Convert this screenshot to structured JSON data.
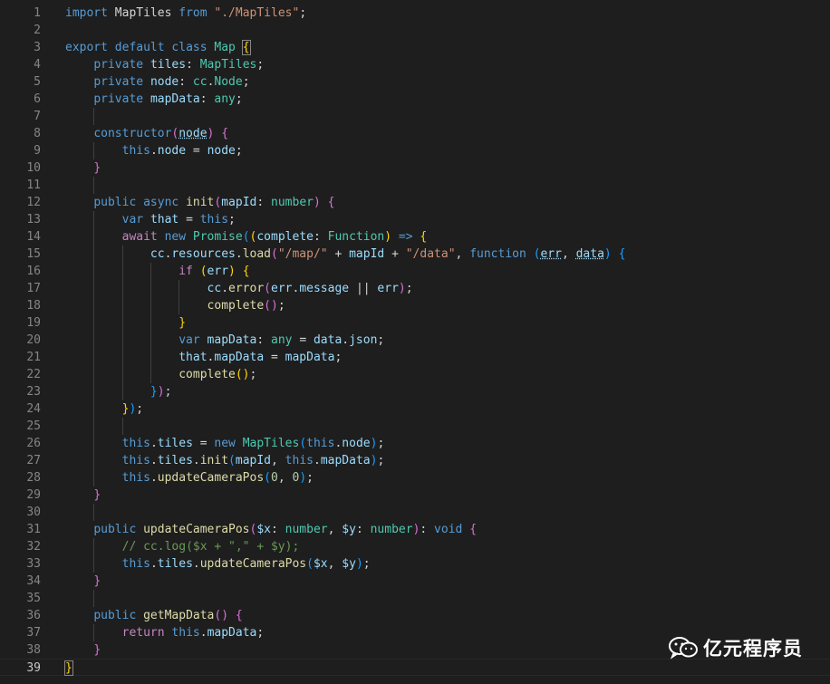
{
  "editor": {
    "current_line": 39,
    "lines": [
      {
        "n": "1",
        "t": [
          [
            "kw",
            "import "
          ],
          [
            "",
            "MapTiles "
          ],
          [
            "kw",
            "from "
          ],
          [
            "str",
            "\"./MapTiles\""
          ],
          [
            "",
            ";"
          ]
        ]
      },
      {
        "n": "2",
        "t": []
      },
      {
        "n": "3",
        "t": [
          [
            "kw",
            "export "
          ],
          [
            "kw",
            "default "
          ],
          [
            "kw",
            "class "
          ],
          [
            "typ",
            "Map "
          ],
          [
            "br1 brm",
            "{"
          ]
        ]
      },
      {
        "n": "4",
        "t": [
          [
            "",
            "    "
          ],
          [
            "kw",
            "private "
          ],
          [
            "var",
            "tiles"
          ],
          [
            "",
            ": "
          ],
          [
            "typ",
            "MapTiles"
          ],
          [
            "",
            ";"
          ]
        ]
      },
      {
        "n": "5",
        "t": [
          [
            "",
            "    "
          ],
          [
            "kw",
            "private "
          ],
          [
            "var",
            "node"
          ],
          [
            "",
            ": "
          ],
          [
            "typ",
            "cc"
          ],
          [
            "",
            "."
          ],
          [
            "typ",
            "Node"
          ],
          [
            "",
            ";"
          ]
        ]
      },
      {
        "n": "6",
        "t": [
          [
            "",
            "    "
          ],
          [
            "kw",
            "private "
          ],
          [
            "var",
            "mapData"
          ],
          [
            "",
            ": "
          ],
          [
            "typ",
            "any"
          ],
          [
            "",
            ";"
          ]
        ]
      },
      {
        "n": "7",
        "t": []
      },
      {
        "n": "8",
        "t": [
          [
            "",
            "    "
          ],
          [
            "kw",
            "constructor"
          ],
          [
            "br2",
            "("
          ],
          [
            "var sq",
            "node"
          ],
          [
            "br2",
            ") "
          ],
          [
            "br2",
            "{"
          ]
        ]
      },
      {
        "n": "9",
        "t": [
          [
            "",
            "        "
          ],
          [
            "kw",
            "this"
          ],
          [
            "",
            "."
          ],
          [
            "var",
            "node "
          ],
          [
            "",
            "= "
          ],
          [
            "var",
            "node"
          ],
          [
            "",
            ";"
          ]
        ]
      },
      {
        "n": "10",
        "t": [
          [
            "",
            "    "
          ],
          [
            "br2",
            "}"
          ]
        ]
      },
      {
        "n": "11",
        "t": []
      },
      {
        "n": "12",
        "t": [
          [
            "",
            "    "
          ],
          [
            "kw",
            "public "
          ],
          [
            "kw",
            "async "
          ],
          [
            "fn",
            "init"
          ],
          [
            "br2",
            "("
          ],
          [
            "var",
            "mapId"
          ],
          [
            "",
            ": "
          ],
          [
            "typ",
            "number"
          ],
          [
            "br2",
            ") "
          ],
          [
            "br2",
            "{"
          ]
        ]
      },
      {
        "n": "13",
        "t": [
          [
            "",
            "        "
          ],
          [
            "kw",
            "var "
          ],
          [
            "var",
            "that "
          ],
          [
            "",
            "= "
          ],
          [
            "kw",
            "this"
          ],
          [
            "",
            ";"
          ]
        ]
      },
      {
        "n": "14",
        "t": [
          [
            "",
            "        "
          ],
          [
            "ctl",
            "await "
          ],
          [
            "kw",
            "new "
          ],
          [
            "typ",
            "Promise"
          ],
          [
            "br3",
            "("
          ],
          [
            "br1",
            "("
          ],
          [
            "var",
            "complete"
          ],
          [
            "",
            ": "
          ],
          [
            "typ",
            "Function"
          ],
          [
            "br1",
            ") "
          ],
          [
            "kw",
            "=> "
          ],
          [
            "br1",
            "{"
          ]
        ]
      },
      {
        "n": "15",
        "t": [
          [
            "",
            "            "
          ],
          [
            "var",
            "cc"
          ],
          [
            "",
            "."
          ],
          [
            "var",
            "resources"
          ],
          [
            "",
            "."
          ],
          [
            "fn",
            "load"
          ],
          [
            "br2",
            "("
          ],
          [
            "str",
            "\"/map/\" "
          ],
          [
            "",
            "+ "
          ],
          [
            "var",
            "mapId "
          ],
          [
            "",
            "+ "
          ],
          [
            "str",
            "\"/data\""
          ],
          [
            "",
            ", "
          ],
          [
            "kw",
            "function "
          ],
          [
            "br3",
            "("
          ],
          [
            "var sq",
            "err"
          ],
          [
            "",
            ", "
          ],
          [
            "var sq",
            "data"
          ],
          [
            "br3",
            ") "
          ],
          [
            "br3",
            "{"
          ]
        ]
      },
      {
        "n": "16",
        "t": [
          [
            "",
            "                "
          ],
          [
            "ctl",
            "if "
          ],
          [
            "br1",
            "("
          ],
          [
            "var",
            "err"
          ],
          [
            "br1",
            ") "
          ],
          [
            "br1",
            "{"
          ]
        ]
      },
      {
        "n": "17",
        "t": [
          [
            "",
            "                    "
          ],
          [
            "var",
            "cc"
          ],
          [
            "",
            "."
          ],
          [
            "fn",
            "error"
          ],
          [
            "br2",
            "("
          ],
          [
            "var",
            "err"
          ],
          [
            "",
            "."
          ],
          [
            "var",
            "message "
          ],
          [
            "",
            "|| "
          ],
          [
            "var",
            "err"
          ],
          [
            "br2",
            ")"
          ],
          [
            "",
            ";"
          ]
        ]
      },
      {
        "n": "18",
        "t": [
          [
            "",
            "                    "
          ],
          [
            "fn",
            "complete"
          ],
          [
            "br2",
            "()"
          ],
          [
            "",
            ";"
          ]
        ]
      },
      {
        "n": "19",
        "t": [
          [
            "",
            "                "
          ],
          [
            "br1",
            "}"
          ]
        ]
      },
      {
        "n": "20",
        "t": [
          [
            "",
            "                "
          ],
          [
            "kw",
            "var "
          ],
          [
            "var",
            "mapData"
          ],
          [
            "",
            ": "
          ],
          [
            "typ",
            "any "
          ],
          [
            "",
            "= "
          ],
          [
            "var",
            "data"
          ],
          [
            "",
            "."
          ],
          [
            "var",
            "json"
          ],
          [
            "",
            ";"
          ]
        ]
      },
      {
        "n": "21",
        "t": [
          [
            "",
            "                "
          ],
          [
            "var",
            "that"
          ],
          [
            "",
            "."
          ],
          [
            "var",
            "mapData "
          ],
          [
            "",
            "= "
          ],
          [
            "var",
            "mapData"
          ],
          [
            "",
            ";"
          ]
        ]
      },
      {
        "n": "22",
        "t": [
          [
            "",
            "                "
          ],
          [
            "fn",
            "complete"
          ],
          [
            "br1",
            "()"
          ],
          [
            "",
            ";"
          ]
        ]
      },
      {
        "n": "23",
        "t": [
          [
            "",
            "            "
          ],
          [
            "br3",
            "}"
          ],
          [
            "br2",
            ")"
          ],
          [
            "",
            ";"
          ]
        ]
      },
      {
        "n": "24",
        "t": [
          [
            "",
            "        "
          ],
          [
            "br1",
            "}"
          ],
          [
            "br3",
            ")"
          ],
          [
            "",
            ";"
          ]
        ]
      },
      {
        "n": "25",
        "t": []
      },
      {
        "n": "26",
        "t": [
          [
            "",
            "        "
          ],
          [
            "kw",
            "this"
          ],
          [
            "",
            "."
          ],
          [
            "var",
            "tiles "
          ],
          [
            "",
            "= "
          ],
          [
            "kw",
            "new "
          ],
          [
            "typ",
            "MapTiles"
          ],
          [
            "br3",
            "("
          ],
          [
            "kw",
            "this"
          ],
          [
            "",
            "."
          ],
          [
            "var",
            "node"
          ],
          [
            "br3",
            ")"
          ],
          [
            "",
            ";"
          ]
        ]
      },
      {
        "n": "27",
        "t": [
          [
            "",
            "        "
          ],
          [
            "kw",
            "this"
          ],
          [
            "",
            "."
          ],
          [
            "var",
            "tiles"
          ],
          [
            "",
            "."
          ],
          [
            "fn",
            "init"
          ],
          [
            "br3",
            "("
          ],
          [
            "var",
            "mapId"
          ],
          [
            "",
            ", "
          ],
          [
            "kw",
            "this"
          ],
          [
            "",
            "."
          ],
          [
            "var",
            "mapData"
          ],
          [
            "br3",
            ")"
          ],
          [
            "",
            ";"
          ]
        ]
      },
      {
        "n": "28",
        "t": [
          [
            "",
            "        "
          ],
          [
            "kw",
            "this"
          ],
          [
            "",
            "."
          ],
          [
            "fn",
            "updateCameraPos"
          ],
          [
            "br3",
            "("
          ],
          [
            "num",
            "0"
          ],
          [
            "",
            ", "
          ],
          [
            "num",
            "0"
          ],
          [
            "br3",
            ")"
          ],
          [
            "",
            ";"
          ]
        ]
      },
      {
        "n": "29",
        "t": [
          [
            "",
            "    "
          ],
          [
            "br2",
            "}"
          ]
        ]
      },
      {
        "n": "30",
        "t": []
      },
      {
        "n": "31",
        "t": [
          [
            "",
            "    "
          ],
          [
            "kw",
            "public "
          ],
          [
            "fn",
            "updateCameraPos"
          ],
          [
            "br2",
            "("
          ],
          [
            "var",
            "$x"
          ],
          [
            "",
            ": "
          ],
          [
            "typ",
            "number"
          ],
          [
            "",
            ", "
          ],
          [
            "var",
            "$y"
          ],
          [
            "",
            ": "
          ],
          [
            "typ",
            "number"
          ],
          [
            "br2",
            ")"
          ],
          [
            "",
            ": "
          ],
          [
            "kw",
            "void "
          ],
          [
            "br2",
            "{"
          ]
        ]
      },
      {
        "n": "32",
        "t": [
          [
            "",
            "        "
          ],
          [
            "com",
            "// cc.log($x + \",\" + $y);"
          ]
        ]
      },
      {
        "n": "33",
        "t": [
          [
            "",
            "        "
          ],
          [
            "kw",
            "this"
          ],
          [
            "",
            "."
          ],
          [
            "var",
            "tiles"
          ],
          [
            "",
            "."
          ],
          [
            "fn",
            "updateCameraPos"
          ],
          [
            "br3",
            "("
          ],
          [
            "var",
            "$x"
          ],
          [
            "",
            ", "
          ],
          [
            "var",
            "$y"
          ],
          [
            "br3",
            ")"
          ],
          [
            "",
            ";"
          ]
        ]
      },
      {
        "n": "34",
        "t": [
          [
            "",
            "    "
          ],
          [
            "br2",
            "}"
          ]
        ]
      },
      {
        "n": "35",
        "t": []
      },
      {
        "n": "36",
        "t": [
          [
            "",
            "    "
          ],
          [
            "kw",
            "public "
          ],
          [
            "fn",
            "getMapData"
          ],
          [
            "br2",
            "() "
          ],
          [
            "br2",
            "{"
          ]
        ]
      },
      {
        "n": "37",
        "t": [
          [
            "",
            "        "
          ],
          [
            "ctl",
            "return "
          ],
          [
            "kw",
            "this"
          ],
          [
            "",
            "."
          ],
          [
            "var",
            "mapData"
          ],
          [
            "",
            ";"
          ]
        ]
      },
      {
        "n": "38",
        "t": [
          [
            "",
            "    "
          ],
          [
            "br2",
            "}"
          ]
        ]
      },
      {
        "n": "39",
        "t": [
          [
            "br1 brm",
            "}"
          ]
        ]
      }
    ]
  },
  "watermark": {
    "text": "亿元程序员",
    "icon": "wechat-icon"
  }
}
